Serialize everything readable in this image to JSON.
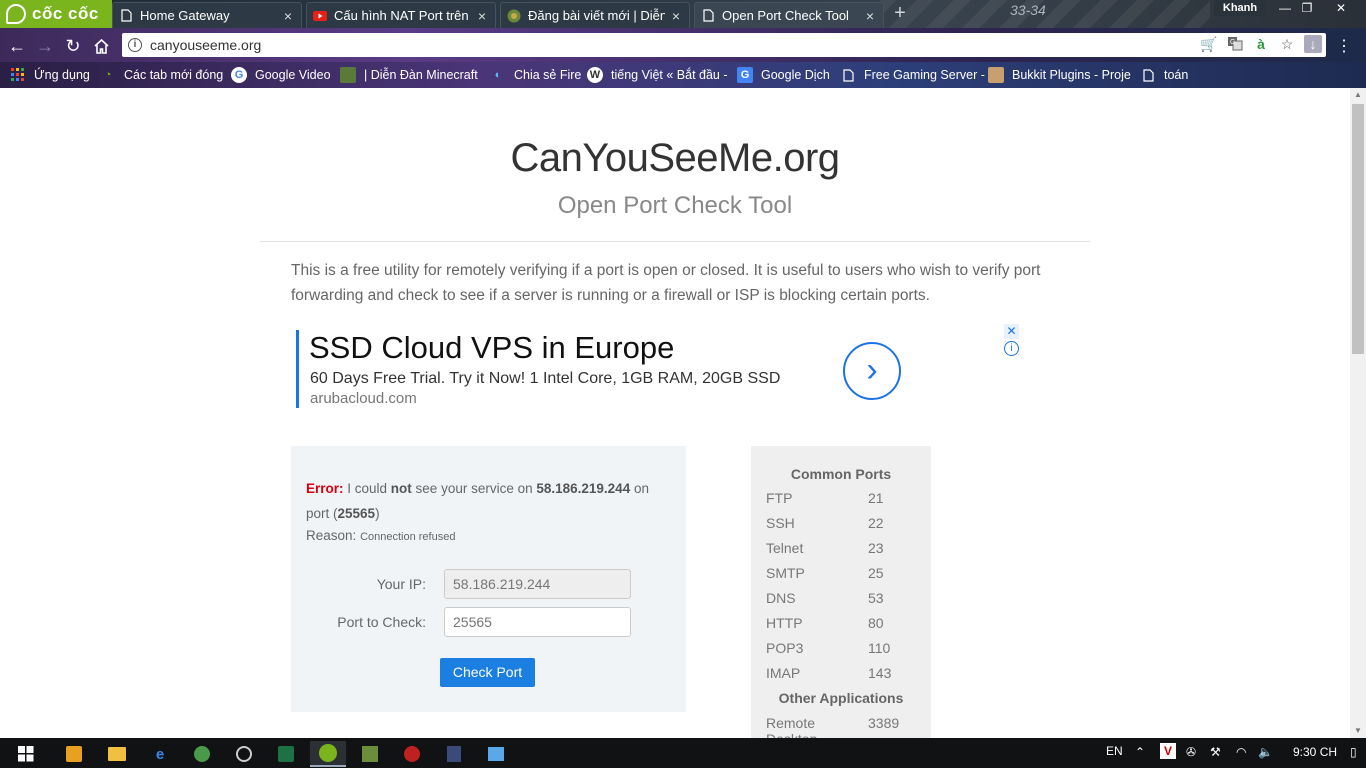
{
  "browser": {
    "brand": "cốc cốc",
    "tabs": [
      {
        "title": "Home Gateway",
        "icon": "page-icon"
      },
      {
        "title": "Cấu hình NAT Port trên thi",
        "icon": "youtube-icon"
      },
      {
        "title": "Đăng bài viết mới | Diễn Đ",
        "icon": "minecraft-icon"
      },
      {
        "title": "Open Port Check Tool",
        "icon": "page-icon"
      }
    ],
    "user": "Khanh",
    "decor_text": "33-34",
    "url": "canyouseeme.org",
    "bookmarks": [
      {
        "label": "Ứng dụng",
        "icon": "apps-grid-icon"
      },
      {
        "label": "Các tab mới đóng",
        "icon": "history-icon"
      },
      {
        "label": "Google Video",
        "icon": "google-icon"
      },
      {
        "label": "| Diễn Đàn Minecraft",
        "icon": "minecraft-icon"
      },
      {
        "label": "Chia sẻ Fire",
        "icon": "fire-icon"
      },
      {
        "label": "tiếng Việt « Bắt đầu -",
        "icon": "wordpress-icon"
      },
      {
        "label": "Google Dịch",
        "icon": "translate-icon"
      },
      {
        "label": "Free Gaming Server -",
        "icon": "page-icon"
      },
      {
        "label": "Bukkit Plugins - Proje",
        "icon": "bukkit-icon"
      },
      {
        "label": "toán",
        "icon": "page-icon"
      }
    ]
  },
  "page": {
    "title": "CanYouSeeMe.org",
    "subtitle": "Open Port Check Tool",
    "intro": "This is a free utility for remotely verifying if a port is open or closed. It is useful to users who wish to verify port forwarding and check to see if a server is running or a firewall or ISP is blocking certain ports.",
    "ad": {
      "headline": "SSD Cloud VPS in Europe",
      "description": "60 Days Free Trial. Try it Now! 1 Intel Core, 1GB RAM, 20GB SSD",
      "domain": "arubacloud.com"
    },
    "result": {
      "error_label": "Error:",
      "text_1": " I could ",
      "not": "not",
      "text_2": " see your service on ",
      "ip": "58.186.219.244",
      "text_3": " on port (",
      "port": "25565",
      "text_4": ")",
      "reason_label": "Reason:",
      "reason": "Connection refused"
    },
    "form": {
      "ip_label": "Your IP:",
      "ip_value": "58.186.219.244",
      "port_label": "Port to Check:",
      "port_value": "25565",
      "button": "Check Port"
    },
    "common_ports": {
      "title": "Common Ports",
      "rows": [
        {
          "name": "FTP",
          "port": "21"
        },
        {
          "name": "SSH",
          "port": "22"
        },
        {
          "name": "Telnet",
          "port": "23"
        },
        {
          "name": "SMTP",
          "port": "25"
        },
        {
          "name": "DNS",
          "port": "53"
        },
        {
          "name": "HTTP",
          "port": "80"
        },
        {
          "name": "POP3",
          "port": "110"
        },
        {
          "name": "IMAP",
          "port": "143"
        }
      ],
      "other_title": "Other Applications",
      "other_rows": [
        {
          "name": "Remote Desktop",
          "port": "3389"
        }
      ]
    }
  },
  "taskbar": {
    "language": "EN",
    "clock": "9:30 CH"
  },
  "colors": {
    "accent": "#1a7fe0",
    "error": "#d9000d",
    "brand_green": "#7ab51d"
  }
}
